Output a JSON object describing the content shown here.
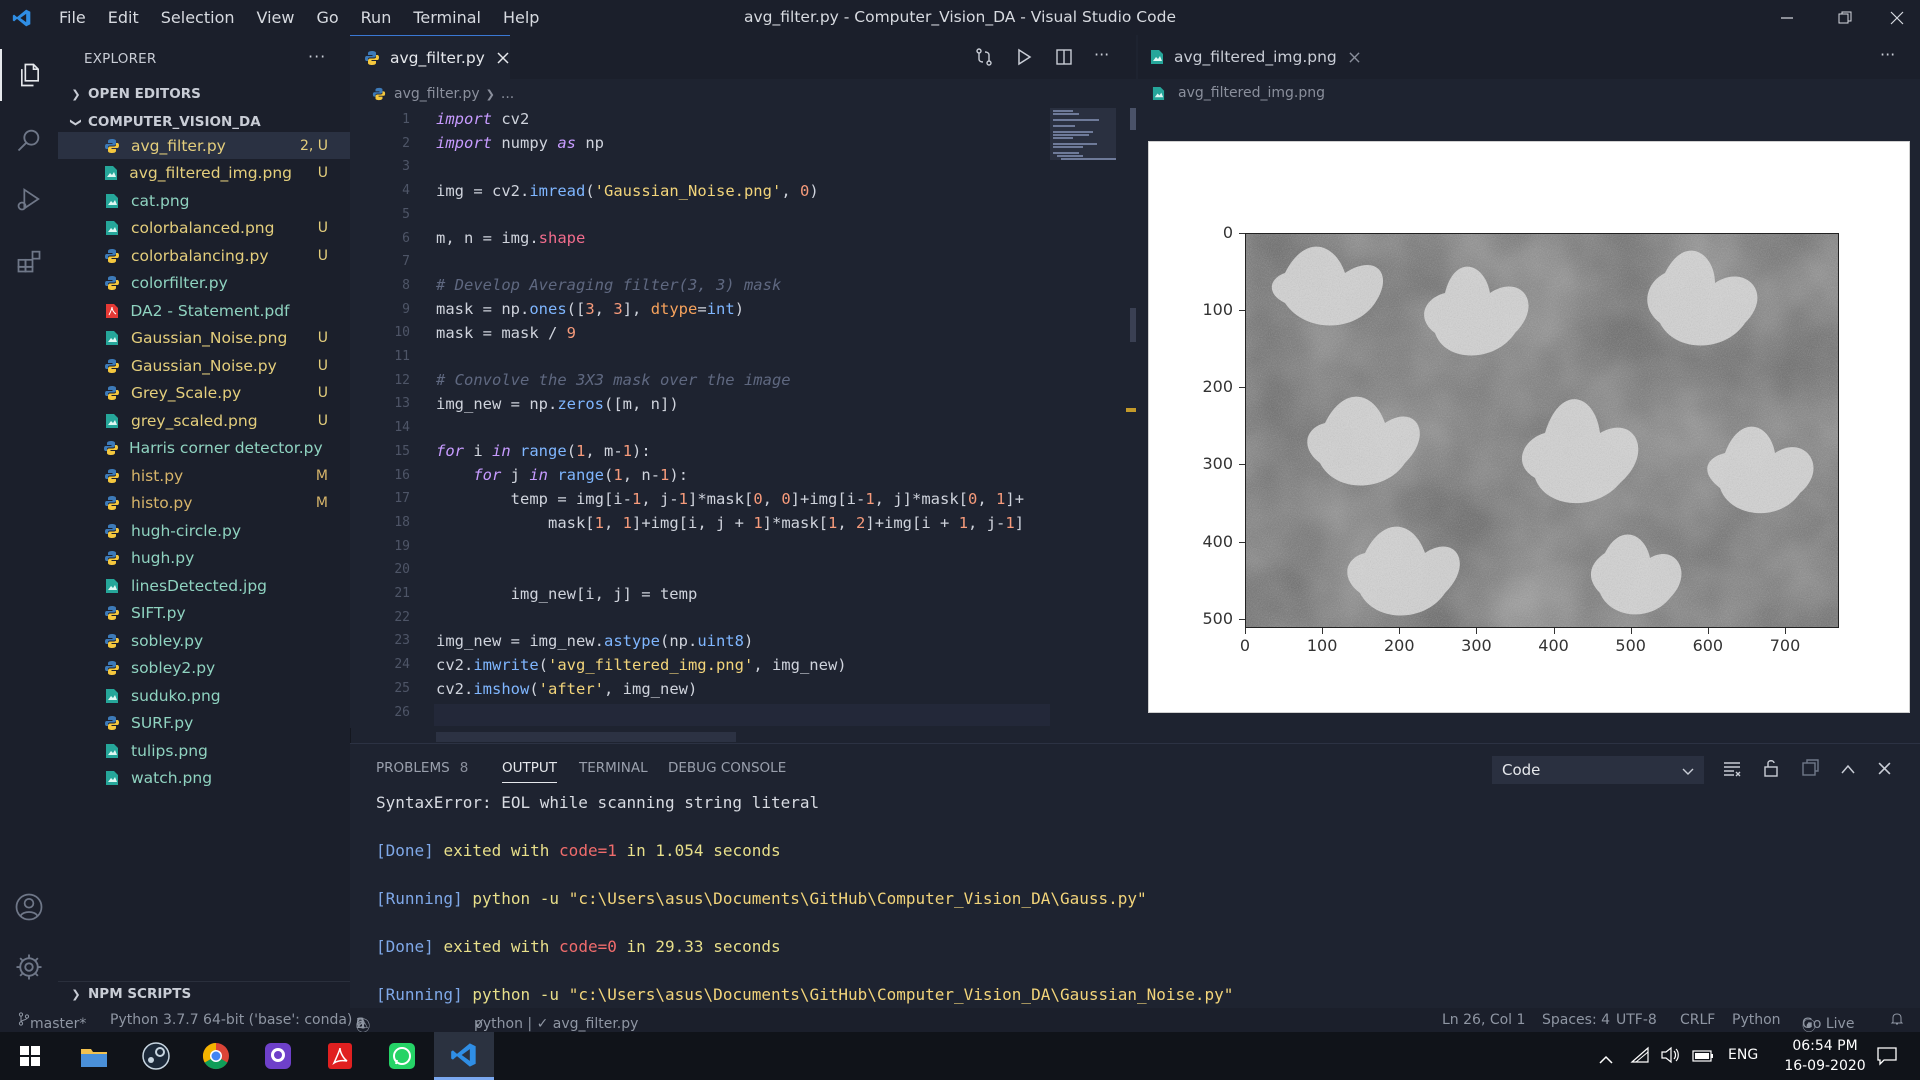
{
  "window": {
    "title": "avg_filter.py - Computer_Vision_DA - Visual Studio Code",
    "menu": [
      "File",
      "Edit",
      "Selection",
      "View",
      "Go",
      "Run",
      "Terminal",
      "Help"
    ]
  },
  "sidebar": {
    "header": "EXPLORER",
    "open_editors": "OPEN EDITORS",
    "folder": "COMPUTER_VISION_DA",
    "npm_scripts": "NPM SCRIPTS",
    "files": [
      {
        "name": "avg_filter.py",
        "status": "2, U",
        "type": "py"
      },
      {
        "name": "avg_filtered_img.png",
        "status": "U",
        "type": "img"
      },
      {
        "name": "cat.png",
        "status": "",
        "type": "img"
      },
      {
        "name": "colorbalanced.png",
        "status": "U",
        "type": "img"
      },
      {
        "name": "colorbalancing.py",
        "status": "U",
        "type": "py"
      },
      {
        "name": "colorfilter.py",
        "status": "",
        "type": "py"
      },
      {
        "name": "DA2 - Statement.pdf",
        "status": "",
        "type": "pdf"
      },
      {
        "name": "Gaussian_Noise.png",
        "status": "U",
        "type": "img"
      },
      {
        "name": "Gaussian_Noise.py",
        "status": "U",
        "type": "py"
      },
      {
        "name": "Grey_Scale.py",
        "status": "U",
        "type": "py"
      },
      {
        "name": "grey_scaled.png",
        "status": "U",
        "type": "img"
      },
      {
        "name": "Harris corner detector.py",
        "status": "",
        "type": "py"
      },
      {
        "name": "hist.py",
        "status": "M",
        "type": "py"
      },
      {
        "name": "histo.py",
        "status": "M",
        "type": "py"
      },
      {
        "name": "hugh-circle.py",
        "status": "",
        "type": "py"
      },
      {
        "name": "hugh.py",
        "status": "",
        "type": "py"
      },
      {
        "name": "linesDetected.jpg",
        "status": "",
        "type": "img"
      },
      {
        "name": "SIFT.py",
        "status": "",
        "type": "py"
      },
      {
        "name": "sobley.py",
        "status": "",
        "type": "py"
      },
      {
        "name": "sobley2.py",
        "status": "",
        "type": "py"
      },
      {
        "name": "suduko.png",
        "status": "",
        "type": "img"
      },
      {
        "name": "SURF.py",
        "status": "",
        "type": "py"
      },
      {
        "name": "tulips.png",
        "status": "",
        "type": "img"
      },
      {
        "name": "watch.png",
        "status": "",
        "type": "img"
      }
    ]
  },
  "editor": {
    "tab": "avg_filter.py",
    "breadcrumb": "avg_filter.py",
    "breadcrumb_more": "...",
    "line_numbers": [
      "1",
      "2",
      "3",
      "4",
      "5",
      "6",
      "7",
      "8",
      "9",
      "10",
      "11",
      "12",
      "13",
      "14",
      "15",
      "16",
      "17",
      "18",
      "19",
      "20",
      "21",
      "22",
      "23",
      "24",
      "25",
      "26"
    ]
  },
  "preview": {
    "tab": "avg_filtered_img.png",
    "breadcrumb": "avg_filtered_img.png",
    "y_ticks": [
      "0",
      "100",
      "200",
      "300",
      "400",
      "500"
    ],
    "x_ticks": [
      "0",
      "100",
      "200",
      "300",
      "400",
      "500",
      "600",
      "700"
    ]
  },
  "panel": {
    "tabs": [
      "PROBLEMS",
      "OUTPUT",
      "TERMINAL",
      "DEBUG CONSOLE"
    ],
    "problems_count": "8",
    "output_select": "Code",
    "lines": {
      "l1": "SyntaxError: EOL while scanning string literal",
      "done": "[Done]",
      "exited": "exited with",
      "code1": "code=1",
      "in": "in",
      "t1": "1.054",
      "seconds": "seconds",
      "running": "[Running]",
      "cmd": "python -u",
      "path1": "\"c:\\Users\\asus\\Documents\\GitHub\\Computer_Vision_DA\\Gauss.py\"",
      "code0": "code=0",
      "t2": "29.33",
      "path2": "\"c:\\Users\\asus\\Documents\\GitHub\\Computer_Vision_DA\\Gaussian_Noise.py\""
    }
  },
  "status": {
    "branch": "master*",
    "interpreter": "Python 3.7.7 64-bit ('base': conda)",
    "errors": "0",
    "warnings": "2",
    "infos": "6",
    "checks": "python | ✓ avg_filter.py",
    "position": "Ln 26, Col 1",
    "spaces": "Spaces: 4",
    "encoding": "UTF-8",
    "eol": "CRLF",
    "language": "Python",
    "golive": "Go Live"
  },
  "taskbar": {
    "lang": "ENG",
    "time": "06:54 PM",
    "date": "16-09-2020"
  }
}
